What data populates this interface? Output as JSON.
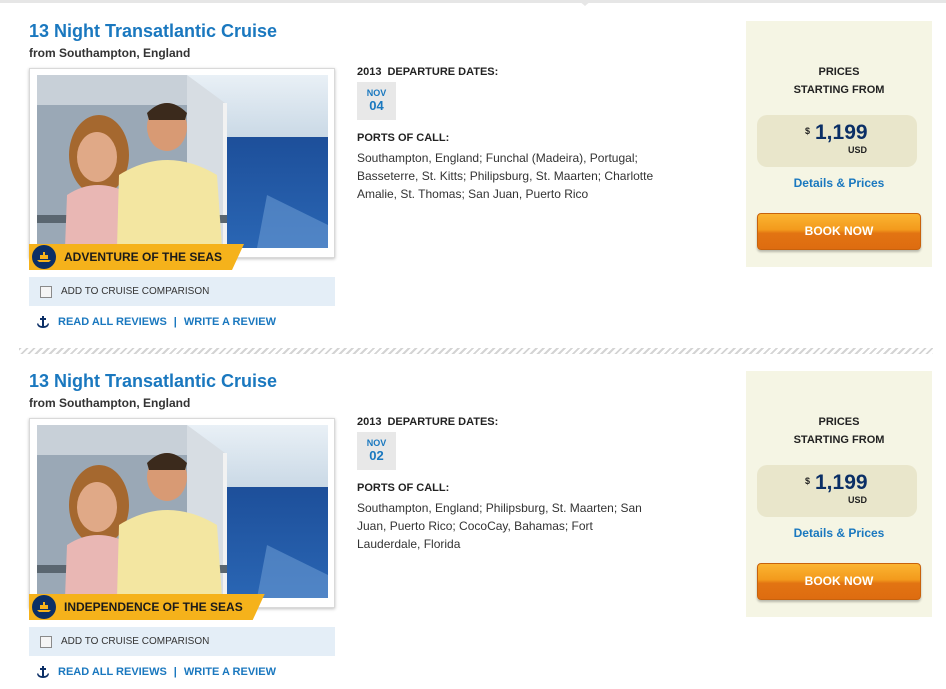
{
  "cruises": [
    {
      "title": "13 Night Transatlantic Cruise",
      "from": "from Southampton, England",
      "ship": "ADVENTURE OF THE SEAS",
      "compare_label": "ADD TO CRUISE COMPARISON",
      "read_reviews": "READ ALL REVIEWS",
      "separator": "|",
      "write_review": "WRITE A REVIEW",
      "departure_year": "2013",
      "departure_label": "DEPARTURE DATES:",
      "date_month": "NOV",
      "date_day": "04",
      "ports_label": "PORTS OF CALL:",
      "ports": "Southampton, England; Funchal (Madeira), Portugal; Basseterre, St. Kitts; Philipsburg, St. Maarten; Charlotte Amalie, St. Thomas; San Juan, Puerto Rico",
      "prices_line1": "PRICES",
      "prices_line2": "STARTING FROM",
      "currency_symbol": "$",
      "price": "1,199",
      "currency": "USD",
      "details_link": "Details & Prices",
      "book_button": "BOOK NOW"
    },
    {
      "title": "13 Night Transatlantic Cruise",
      "from": "from Southampton, England",
      "ship": "INDEPENDENCE OF THE SEAS",
      "compare_label": "ADD TO CRUISE COMPARISON",
      "read_reviews": "READ ALL REVIEWS",
      "separator": "|",
      "write_review": "WRITE A REVIEW",
      "departure_year": "2013",
      "departure_label": "DEPARTURE DATES:",
      "date_month": "NOV",
      "date_day": "02",
      "ports_label": "PORTS OF CALL:",
      "ports": "Southampton, England; Philipsburg, St. Maarten; San Juan, Puerto Rico; CocoCay, Bahamas; Fort Lauderdale, Florida",
      "prices_line1": "PRICES",
      "prices_line2": "STARTING FROM",
      "currency_symbol": "$",
      "price": "1,199",
      "currency": "USD",
      "details_link": "Details & Prices",
      "book_button": "BOOK NOW"
    }
  ],
  "colors": {
    "link_blue": "#1a78bf",
    "navy": "#0b2f66",
    "banner_gold": "#f5b21b",
    "price_panel": "#f5f5e4",
    "button_orange": "#e27412"
  },
  "icons": [
    "anchor-icon",
    "crown-anchor-logo-icon",
    "checkbox-icon"
  ]
}
